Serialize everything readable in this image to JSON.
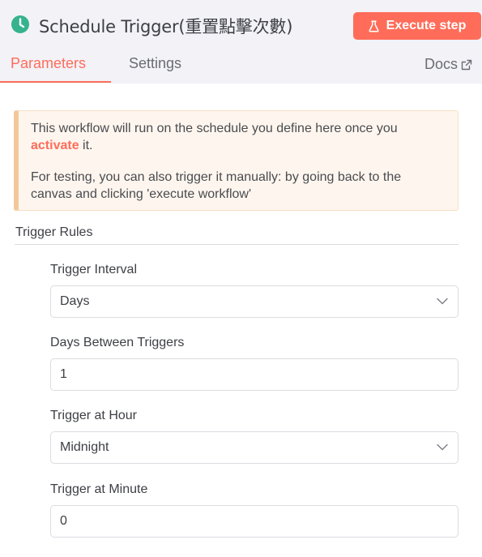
{
  "header": {
    "title": "Schedule Trigger(重置點擊次數)",
    "execute_label": "Execute step",
    "icon": "clock-icon",
    "accent_color": "#ff6d5a",
    "node_color": "#35b38c"
  },
  "tabs": [
    {
      "label": "Parameters",
      "active": true
    },
    {
      "label": "Settings",
      "active": false
    }
  ],
  "docs_label": "Docs",
  "callout": {
    "line1_before": "This workflow will run on the schedule you define here once you ",
    "line1_link": "activate",
    "line1_after": " it.",
    "line2": "For testing, you can also trigger it manually: by going back to the canvas and clicking 'execute workflow'"
  },
  "section": {
    "title": "Trigger Rules"
  },
  "fields": [
    {
      "label": "Trigger Interval",
      "value": "Days",
      "type": "select"
    },
    {
      "label": "Days Between Triggers",
      "value": "1",
      "type": "number"
    },
    {
      "label": "Trigger at Hour",
      "value": "Midnight",
      "type": "select"
    },
    {
      "label": "Trigger at Minute",
      "value": "0",
      "type": "number"
    }
  ]
}
